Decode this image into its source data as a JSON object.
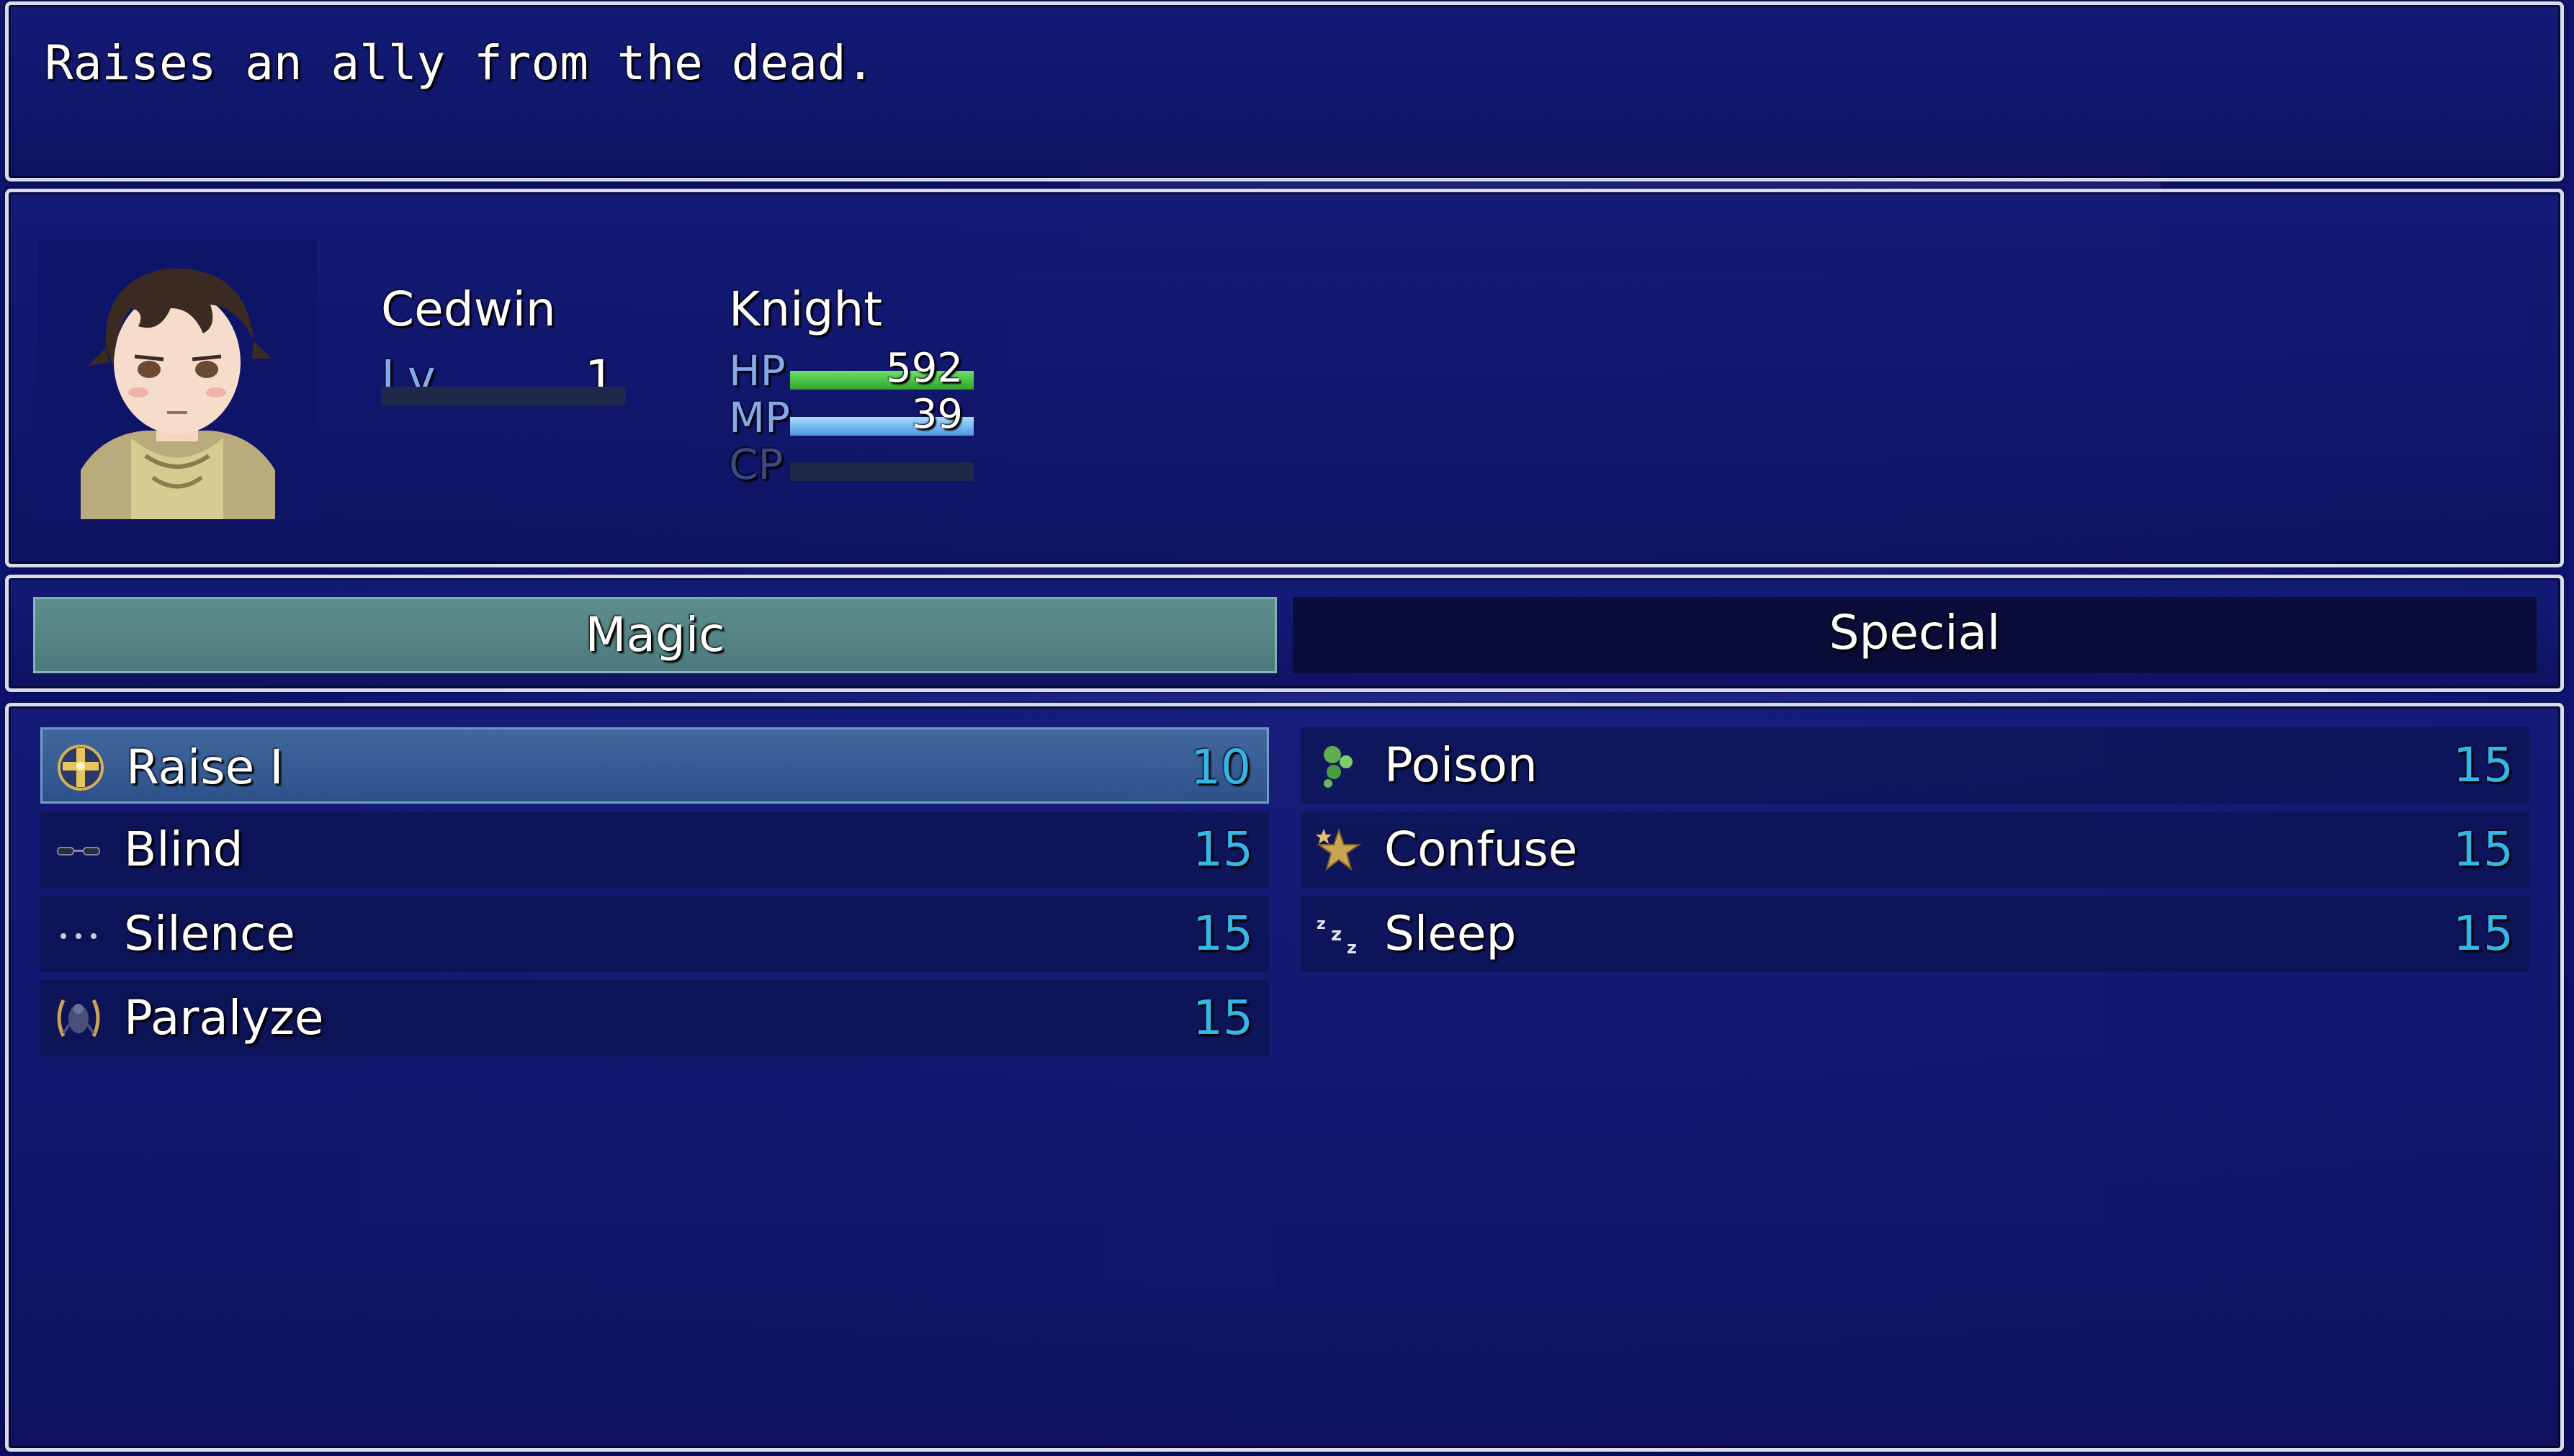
{
  "help": {
    "text": "Raises an ally from the dead."
  },
  "actor": {
    "name": "Cedwin",
    "class": "Knight",
    "level_label": "Lv",
    "level": "1",
    "hp_label": "HP",
    "hp": "592",
    "hp_fraction": 1.0,
    "mp_label": "MP",
    "mp": "39",
    "mp_fraction": 1.0,
    "cp_label": "CP",
    "cp_fraction": 0.0
  },
  "tabs": [
    {
      "label": "Magic",
      "selected": true
    },
    {
      "label": "Special",
      "selected": false
    }
  ],
  "skills": [
    {
      "name": "Raise I",
      "cost": "10",
      "icon": "holy-cross-icon",
      "selected": true
    },
    {
      "name": "Poison",
      "cost": "15",
      "icon": "poison-bubbles-icon",
      "selected": false
    },
    {
      "name": "Blind",
      "cost": "15",
      "icon": "sunglasses-icon",
      "selected": false
    },
    {
      "name": "Confuse",
      "cost": "15",
      "icon": "stars-icon",
      "selected": false
    },
    {
      "name": "Silence",
      "cost": "15",
      "icon": "ellipsis-icon",
      "selected": false
    },
    {
      "name": "Sleep",
      "cost": "15",
      "icon": "zzz-icon",
      "selected": false
    },
    {
      "name": "Paralyze",
      "cost": "15",
      "icon": "paralyze-spirit-icon",
      "selected": false
    }
  ],
  "colors": {
    "hp_gauge": "#3fbf3a",
    "mp_gauge": "#6fb8f0",
    "cost_text": "#35b6e6",
    "system_text": "#84a8ec"
  }
}
